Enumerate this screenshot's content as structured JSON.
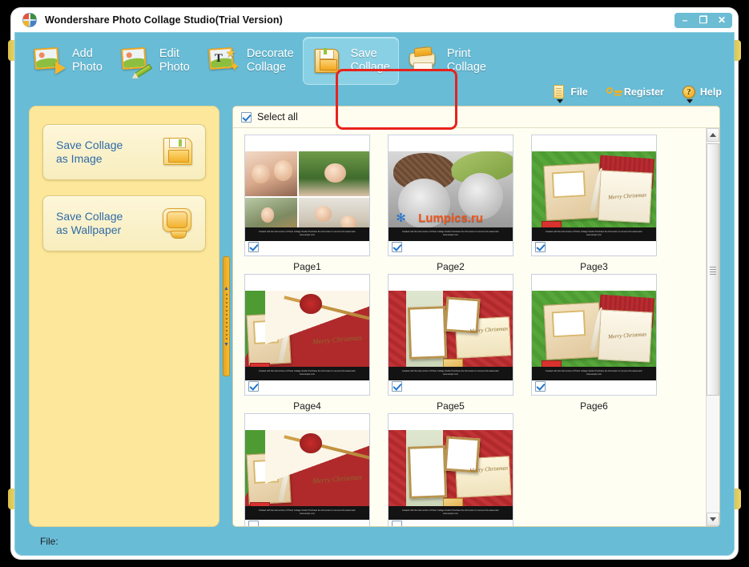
{
  "window": {
    "title": "Wondershare Photo Collage Studio(Trial Version)",
    "logo_icon": "wondershare-logo-icon",
    "controls": {
      "minimize": "–",
      "maximize": "❐",
      "close": "✕"
    }
  },
  "toolbar": {
    "buttons": [
      {
        "label": "Add\nPhoto",
        "icon": "add-photo-icon",
        "active": false
      },
      {
        "label": "Edit\nPhoto",
        "icon": "edit-photo-icon",
        "active": false
      },
      {
        "label": "Decorate\nCollage",
        "icon": "decorate-collage-icon",
        "active": false
      },
      {
        "label": "Save\nCollage",
        "icon": "save-collage-icon",
        "active": true
      },
      {
        "label": "Print\nCollage",
        "icon": "print-collage-icon",
        "active": false
      }
    ],
    "menu": [
      {
        "label": "File",
        "icon": "file-document-icon",
        "has_caret": true
      },
      {
        "label": "Register",
        "icon": "key-icon",
        "has_caret": false
      },
      {
        "label": "Help",
        "icon": "question-mark-icon",
        "has_caret": true
      }
    ],
    "highlight": {
      "target": "Save Collage",
      "color": "#e8221c"
    }
  },
  "sidebar": {
    "buttons": [
      {
        "label": "Save Collage\nas Image",
        "icon": "floppy-disk-icon"
      },
      {
        "label": "Save Collage\nas Wallpaper",
        "icon": "monitor-icon"
      }
    ]
  },
  "splitter": {
    "name": "panel-splitter",
    "arrow_up": "▲",
    "arrow_down": "▼"
  },
  "pages_panel": {
    "select_all": {
      "label": "Select all",
      "checked": true
    },
    "watermark_text": "Created with the trial version of Photo Collage Studio! Purchase the full version to remove this watermark.\nwww.acspic.com",
    "pages": [
      {
        "caption": "Page1",
        "checked": true,
        "art": "collage"
      },
      {
        "caption": "Page2",
        "checked": true,
        "art": "portrait",
        "overlay_text": "Lumpics.ru"
      },
      {
        "caption": "Page3",
        "checked": true,
        "art": "xmas-green",
        "art_text": "Merry Christmas"
      },
      {
        "caption": "Page4",
        "checked": true,
        "art": "xmas-red",
        "art_text": "Merry Christmas"
      },
      {
        "caption": "Page5",
        "checked": true,
        "art": "frames",
        "art_text": "Merry Christmas"
      },
      {
        "caption": "Page6",
        "checked": true,
        "art": "xmas-green",
        "art_text": "Merry Christmas"
      },
      {
        "caption": "",
        "checked": false,
        "art": "xmas-red",
        "art_text": "Merry Christmas"
      },
      {
        "caption": "",
        "checked": false,
        "art": "frames",
        "art_text": "Merry Christmas"
      }
    ],
    "scrollbar": {
      "up": "▲",
      "down": "▼",
      "position_percent": 2
    }
  },
  "status_bar": {
    "text": "File:"
  },
  "colors": {
    "window_chrome": "#68bcd6",
    "toolbar_active": "#8ad0e4",
    "sidebar_bg": "#fce79b",
    "panel_bg": "#fffef2",
    "link_text": "#2e6ba8",
    "highlight_red": "#e8221c"
  }
}
